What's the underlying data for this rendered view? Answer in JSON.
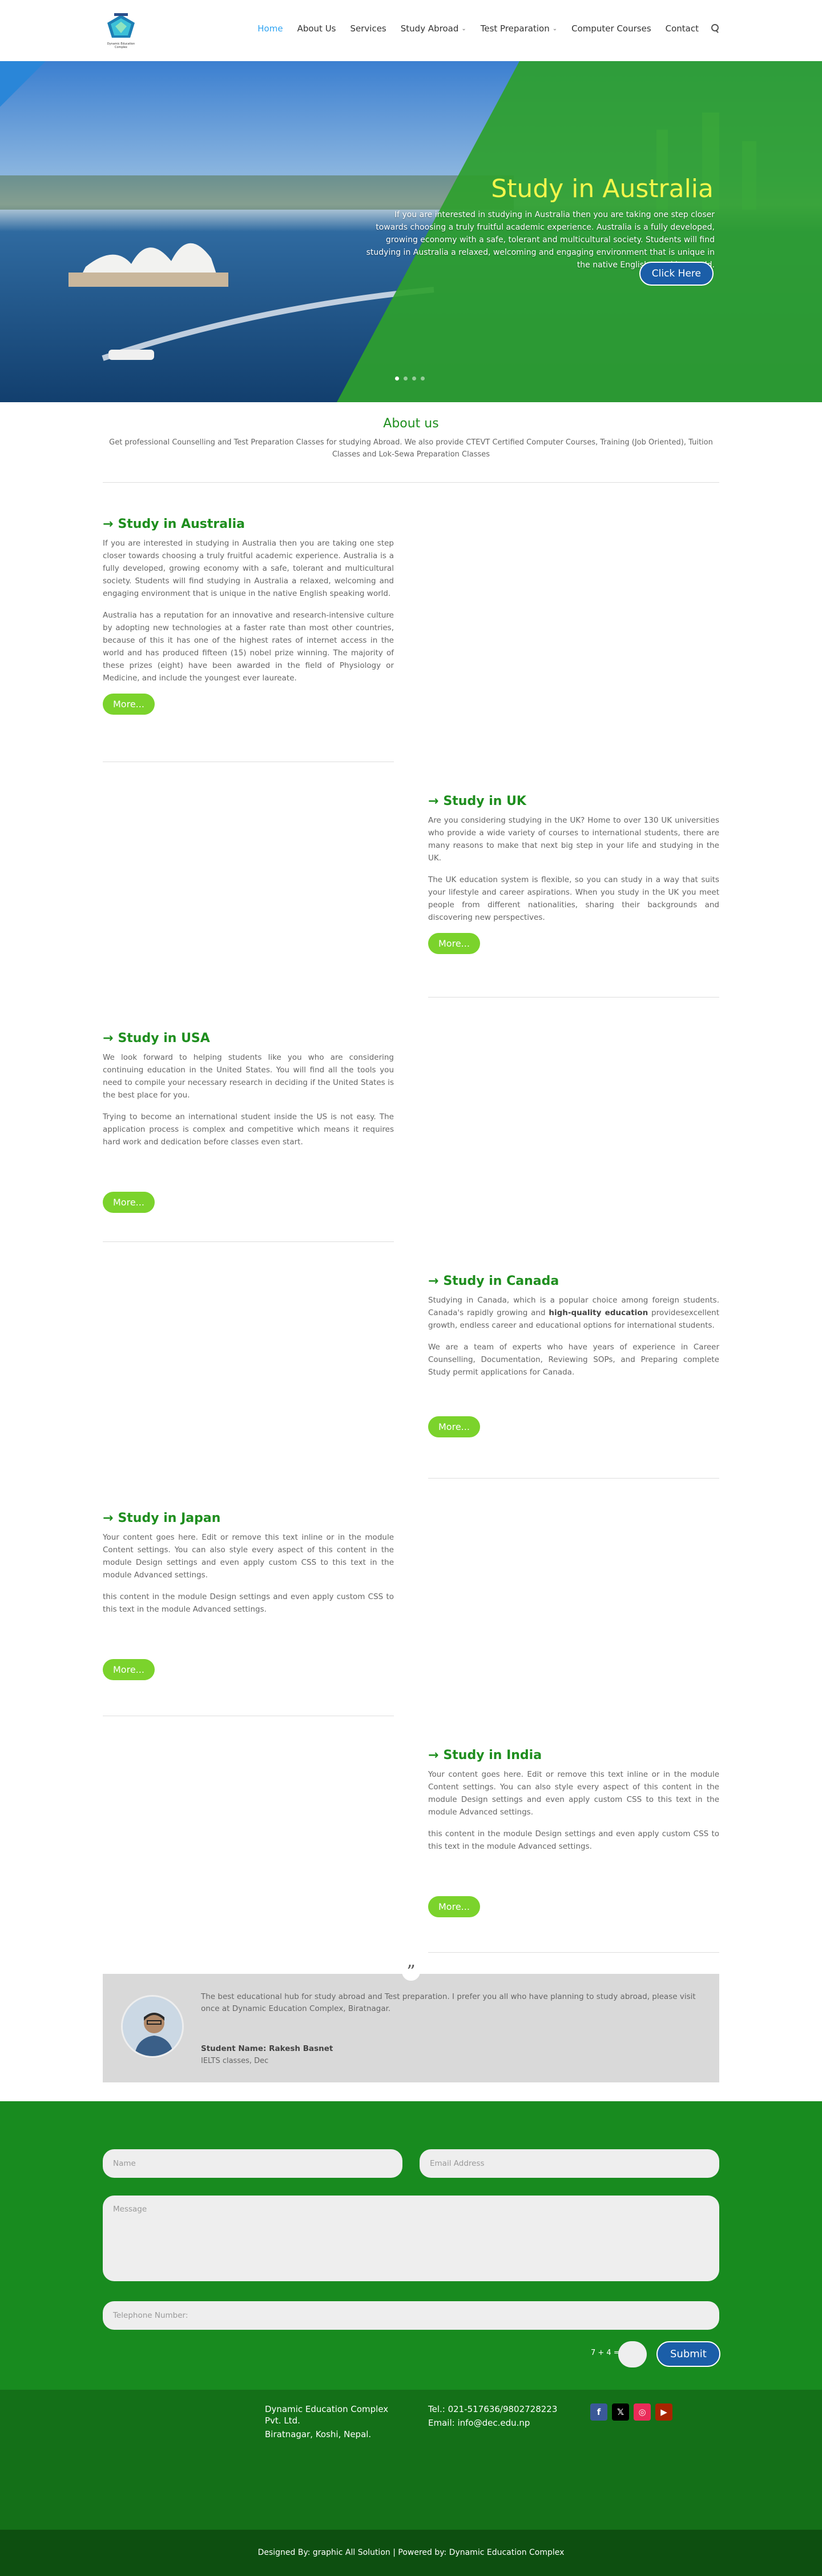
{
  "logo": {
    "text": "Dynamic Education Complex"
  },
  "nav": {
    "items": [
      {
        "label": "Home",
        "active": true,
        "dropdown": false
      },
      {
        "label": "About Us",
        "active": false,
        "dropdown": false
      },
      {
        "label": "Services",
        "active": false,
        "dropdown": false
      },
      {
        "label": "Study Abroad",
        "active": false,
        "dropdown": true
      },
      {
        "label": "Test Preparation",
        "active": false,
        "dropdown": true
      },
      {
        "label": "Computer Courses",
        "active": false,
        "dropdown": false
      },
      {
        "label": "Contact",
        "active": false,
        "dropdown": false
      }
    ]
  },
  "hero": {
    "title": "Study in Australia",
    "text": "If you are interested in studying in Australia then you are taking one step closer towards choosing a truly fruitful academic experience. Australia is a fully developed, growing economy with a safe, tolerant and multicultural society. Students will find studying in Australia a relaxed, welcoming and engaging environment that is unique in the native English speaking world.",
    "button": "Click Here"
  },
  "about": {
    "title": "About us",
    "text": "Get professional Counselling and Test Preparation Classes for studying Abroad. We also provide CTEVT Certified Computer Courses, Training (Job Oriented), Tuition Classes and Lok-Sewa Preparation Classes"
  },
  "studies": [
    {
      "title": "Study in Australia",
      "paragraphs": [
        "If you are interested in studying in Australia then you are taking one step closer towards choosing a truly fruitful academic experience. Australia is a fully developed, growing economy with a safe, tolerant and multicultural society. Students will find studying in Australia a relaxed, welcoming and engaging environment that is unique in the native English speaking world.",
        "Australia has a reputation for an innovative and research-intensive culture by adopting new technologies at a faster rate than most other countries, because of this it has one of the highest rates of internet access in the world and has produced fifteen (15) nobel prize winning. The majority of these prizes (eight) have been awarded in the field of Physiology or Medicine, and include the youngest ever laureate."
      ],
      "button": "More..."
    },
    {
      "title": "Study in UK",
      "paragraphs": [
        "Are you considering studying in the UK? Home to over 130 UK universities who provide a wide variety of courses to international students, there are many reasons to make that next big step in your life and studying in the UK.",
        "The UK education system is flexible, so you can study in a way that suits your lifestyle and career aspirations. When you study in the UK you meet people from different nationalities, sharing their backgrounds and discovering new perspectives."
      ],
      "button": "More..."
    },
    {
      "title": "Study in USA",
      "paragraphs": [
        "We look forward to helping students like you who are considering continuing education in the United States. You will find all the tools you need to compile your necessary research in deciding if the United States is the best place for you.",
        "Trying to become an international student inside the US is not easy. The application process is complex and competitive which means it requires hard work and dedication before classes even start."
      ],
      "button": "More..."
    },
    {
      "title": "Study in Canada",
      "paragraphs": [
        "Studying in Canada, which is a popular choice among foreign students. Canada's rapidly growing and high-quality education providesexcellent growth, endless career and educational options for international students.",
        "We are a team of experts who have years of experience in Career Counselling, Documentation, Reviewing SOPs, and Preparing complete Study permit applications for Canada."
      ],
      "button": "More..."
    },
    {
      "title": "Study in Japan",
      "paragraphs": [
        "Your content goes here. Edit or remove this text inline or in the module Content settings. You can also style every aspect of this content in the module Design settings and even apply custom CSS to this text in the module Advanced settings.",
        "this content in the module Design settings and even apply custom CSS to this text in the module Advanced settings."
      ],
      "button": "More..."
    },
    {
      "title": "Study in India",
      "paragraphs": [
        "Your content goes here. Edit or remove this text inline or in the module Content settings. You can also style every aspect of this content in the module Design settings and even apply custom CSS to this text in the module Advanced settings.",
        "this content in the module Design settings and even apply custom CSS to this text in the module Advanced settings."
      ],
      "button": "More..."
    }
  ],
  "canada_bold": "high-quality education",
  "testimonial": {
    "text": "The best educational hub for study abroad and Test preparation. I prefer you all who have planning to study abroad, please visit once at Dynamic Education Complex, Biratnagar.",
    "name": "Student Name: Rakesh Basnet",
    "role": "IELTS classes, Dec"
  },
  "form": {
    "name_placeholder": "Name",
    "email_placeholder": "Email Address",
    "message_placeholder": "Message",
    "phone_placeholder": "Telephone Number:",
    "captcha": "7 + 4 =",
    "submit": "Submit"
  },
  "footer": {
    "company_line1": "Dynamic Education Complex",
    "company_line2": "Pvt. Ltd.",
    "address": "Biratnagar, Koshi, Nepal.",
    "tel": "Tel.: 021-517636/9802728223",
    "email": "Email: info@dec.edu.np",
    "socials": [
      {
        "icon": "facebook-icon",
        "glyph": "f",
        "color": "#3b5998"
      },
      {
        "icon": "x-icon",
        "glyph": "𝕏",
        "color": "#000000"
      },
      {
        "icon": "instagram-icon",
        "glyph": "◎",
        "color": "#ea2c59"
      },
      {
        "icon": "youtube-icon",
        "glyph": "▶",
        "color": "#a82400"
      }
    ],
    "credits": "Designed By: graphic All Solution  |  Powered by: Dynamic Education Complex"
  },
  "colors": {
    "accent_green": "#1e8e1e",
    "button_green": "#7bd32c",
    "brand_blue": "#1b5ea8",
    "nav_active": "#2ea3f2"
  }
}
